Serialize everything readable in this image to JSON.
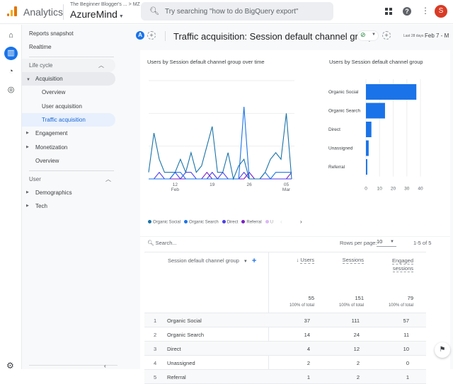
{
  "topbar": {
    "app_name": "Analytics",
    "account_path": "The Beginner Blogger's ... > MZ",
    "property_name": "AzureMind",
    "search_placeholder": "Try searching \"how to do BigQuery export\"",
    "avatar_initial": "S",
    "icons": [
      "analytics-logo",
      "search-icon",
      "apps-grid-icon",
      "help-icon",
      "more-vert-icon"
    ]
  },
  "rail": {
    "items": [
      {
        "name": "home-icon",
        "active": false
      },
      {
        "name": "reports-icon",
        "active": true
      },
      {
        "name": "explore-icon",
        "active": false
      },
      {
        "name": "advertising-icon",
        "active": false
      }
    ],
    "settings_icon": "gear-icon"
  },
  "nav": {
    "reports_snapshot": "Reports snapshot",
    "realtime": "Realtime",
    "lifecycle_header": "Life cycle",
    "acquisition": "Acquisition",
    "acquisition_overview": "Overview",
    "user_acquisition": "User acquisition",
    "traffic_acquisition": "Traffic acquisition",
    "engagement": "Engagement",
    "monetization": "Monetization",
    "overview": "Overview",
    "user_header": "User",
    "demographics": "Demographics",
    "tech": "Tech"
  },
  "header": {
    "comparison_badge": "A",
    "title": "Traffic acquisition: Session default channel group",
    "date_label": "Last 28 days",
    "date_range": "Feb 7 - M"
  },
  "line_chart": {
    "title": "Users by Session default channel group over time"
  },
  "bar_chart": {
    "title": "Users by Session default channel group"
  },
  "legend": {
    "items": [
      {
        "label": "Organic Social",
        "color": "#1a73a8"
      },
      {
        "label": "Organic Search",
        "color": "#1a73e8"
      },
      {
        "label": "Direct",
        "color": "#4c3de8"
      },
      {
        "label": "Referral",
        "color": "#7b1fc2"
      },
      {
        "label": "U",
        "color": "#c58af0"
      }
    ],
    "prev": "‹",
    "next": "›"
  },
  "table": {
    "search_placeholder": "Search...",
    "rows_per_page_label": "Rows per page:",
    "rows_per_page": "10",
    "pagination": "1-5 of 5",
    "dimension_header": "Session default channel group",
    "columns": [
      "Users",
      "Sessions",
      "Engaged",
      "sessions"
    ],
    "sort_indicator": "↓",
    "totals": {
      "users": "55",
      "sessions": "151",
      "engaged": "79",
      "pct_label": "100% of total"
    },
    "rows": [
      {
        "idx": "1",
        "channel": "Organic Social",
        "users": "37",
        "sessions": "111",
        "engaged": "57"
      },
      {
        "idx": "2",
        "channel": "Organic Search",
        "users": "14",
        "sessions": "24",
        "engaged": "11"
      },
      {
        "idx": "3",
        "channel": "Direct",
        "users": "4",
        "sessions": "12",
        "engaged": "10"
      },
      {
        "idx": "4",
        "channel": "Unassigned",
        "users": "2",
        "sessions": "2",
        "engaged": "0"
      },
      {
        "idx": "5",
        "channel": "Referral",
        "users": "1",
        "sessions": "2",
        "engaged": "1"
      }
    ]
  },
  "chart_data": [
    {
      "type": "line",
      "title": "Users by Session default channel group over time",
      "x": [
        "Feb 7",
        "Feb 8",
        "Feb 9",
        "Feb 10",
        "Feb 11",
        "Feb 12",
        "Feb 13",
        "Feb 14",
        "Feb 15",
        "Feb 16",
        "Feb 17",
        "Feb 18",
        "Feb 19",
        "Feb 20",
        "Feb 21",
        "Feb 22",
        "Feb 23",
        "Feb 24",
        "Feb 25",
        "Feb 26",
        "Feb 27",
        "Feb 28",
        "Mar 1",
        "Mar 2",
        "Mar 3",
        "Mar 4",
        "Mar 5",
        "Mar 6"
      ],
      "x_ticks": [
        {
          "label": "12",
          "sub": "Feb",
          "index": 5
        },
        {
          "label": "19",
          "sub": "",
          "index": 12
        },
        {
          "label": "26",
          "sub": "",
          "index": 19
        },
        {
          "label": "05",
          "sub": "Mar",
          "index": 26
        }
      ],
      "y_ticks": [
        0,
        5,
        10,
        15
      ],
      "ylim": [
        0,
        15
      ],
      "grid": true,
      "series": [
        {
          "name": "Organic Social",
          "color": "#1a73a8",
          "values": [
            1,
            7,
            3,
            1,
            1,
            1,
            3,
            1,
            4,
            1,
            2,
            5,
            8,
            1,
            1,
            4,
            0,
            2,
            3,
            0,
            0,
            0,
            1,
            3,
            4,
            3,
            10,
            0
          ]
        },
        {
          "name": "Organic Search",
          "color": "#1a73e8",
          "values": [
            0,
            0,
            0,
            0,
            0,
            1,
            1,
            0,
            0,
            0,
            0,
            0,
            0,
            0,
            0,
            0,
            0,
            0,
            11,
            0,
            0,
            0,
            1,
            0,
            1,
            1,
            1,
            1
          ]
        },
        {
          "name": "Direct",
          "color": "#4c3de8",
          "values": [
            0,
            0,
            1,
            0,
            0,
            1,
            0,
            1,
            1,
            0,
            0,
            0,
            1,
            0,
            1,
            0,
            0,
            0,
            1,
            0,
            0,
            0,
            0,
            0,
            0,
            0,
            0,
            0
          ]
        },
        {
          "name": "Referral",
          "color": "#7b1fc2",
          "values": [
            0,
            0,
            0,
            0,
            0,
            0,
            0,
            0,
            0,
            0,
            0,
            1,
            0,
            0,
            0,
            0,
            0,
            0,
            0,
            1,
            0,
            0,
            0,
            0,
            0,
            0,
            0,
            1
          ]
        },
        {
          "name": "Unassigned",
          "color": "#c58af0",
          "values": [
            0,
            0,
            0,
            0,
            0,
            0,
            0,
            0,
            0,
            0,
            0,
            0,
            1,
            0,
            0,
            0,
            0,
            0,
            0,
            1,
            0,
            0,
            0,
            0,
            0,
            0,
            0,
            0
          ]
        }
      ],
      "legend": "bottom"
    },
    {
      "type": "bar",
      "orientation": "horizontal",
      "title": "Users by Session default channel group",
      "categories": [
        "Organic Social",
        "Organic Search",
        "Direct",
        "Unassigned",
        "Referral"
      ],
      "values": [
        37,
        14,
        4,
        2,
        1
      ],
      "color": "#1a73e8",
      "x_ticks": [
        0,
        10,
        20,
        30,
        40
      ],
      "xlim": [
        0,
        40
      ],
      "grid": true
    }
  ]
}
